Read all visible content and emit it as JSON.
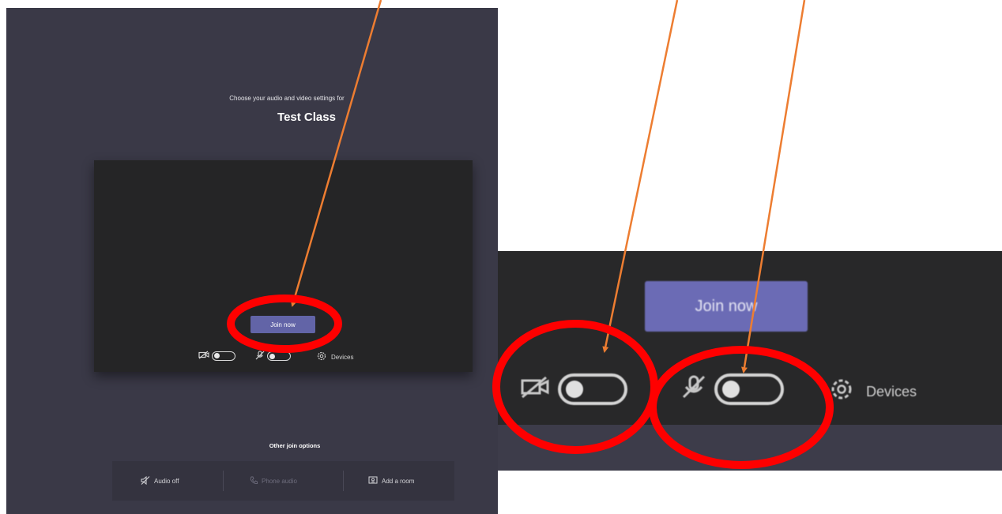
{
  "prejoin": {
    "prompt": "Choose your audio and video settings for",
    "meeting_title": "Test Class",
    "join_label": "Join now",
    "devices_label": "Devices",
    "other_options": {
      "title": "Other join options",
      "audio_off": "Audio off",
      "phone_audio": "Phone audio",
      "add_room": "Add a room"
    }
  },
  "zoomed": {
    "join_label": "Join now",
    "devices_label": "Devices"
  },
  "toggles": {
    "camera_on": false,
    "mic_on": false
  },
  "colors": {
    "background": "#3a3947",
    "preview": "#252526",
    "join_button": "#6264a7",
    "annotation_circle": "#ff0000",
    "annotation_arrow": "#ed7d31"
  },
  "icons": {
    "camera": "camera-off-icon",
    "mic": "mic-off-icon",
    "devices": "gear-icon",
    "speaker": "speaker-off-icon",
    "phone": "phone-icon",
    "room": "room-icon"
  }
}
